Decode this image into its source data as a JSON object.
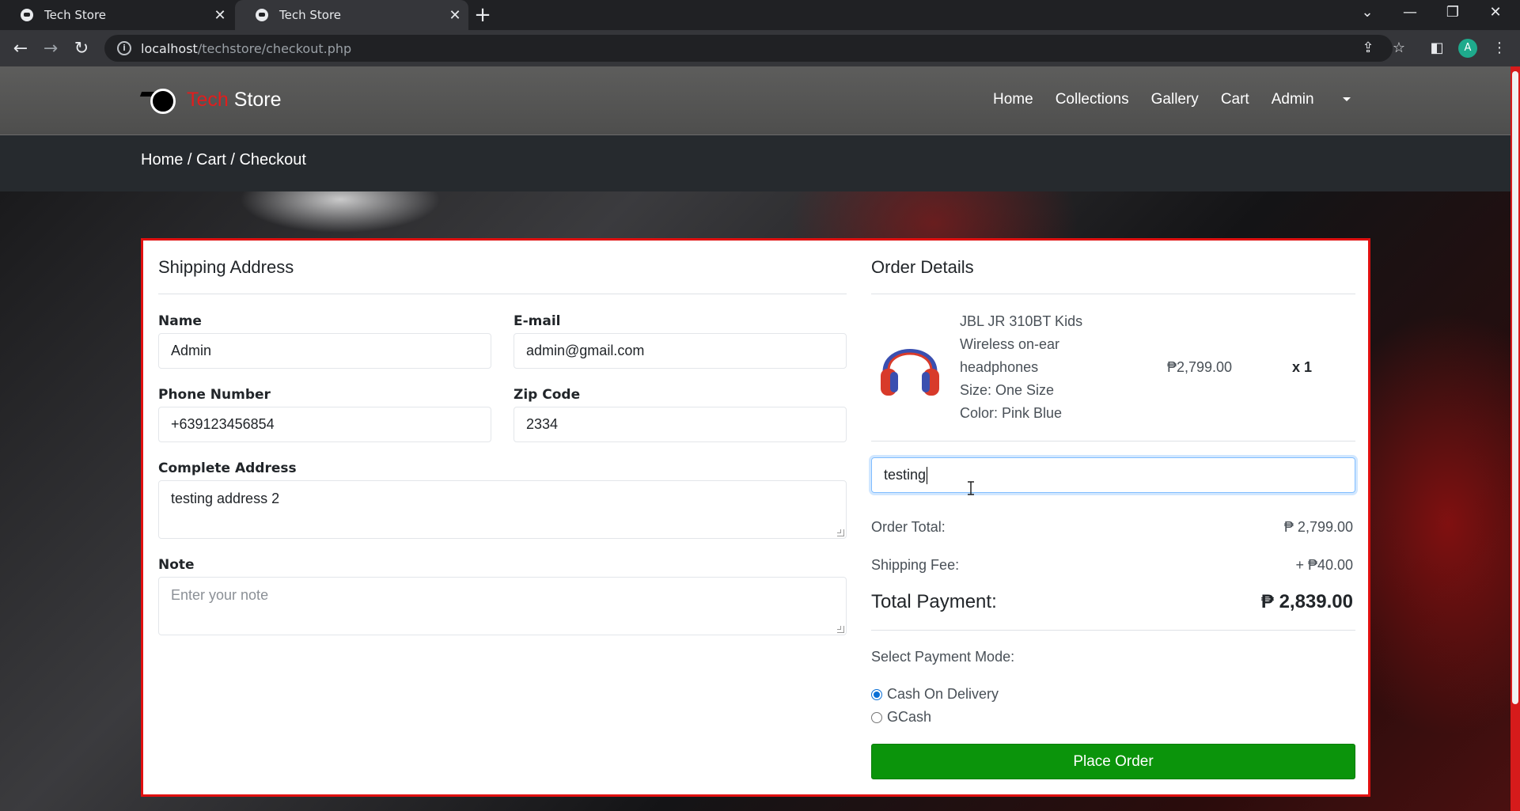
{
  "browser": {
    "tabs": [
      {
        "title": "Tech Store",
        "active": false
      },
      {
        "title": "Tech Store",
        "active": true
      }
    ],
    "url_host": "localhost",
    "url_path": "/techstore/checkout.php",
    "profile_initial": "A"
  },
  "site": {
    "brand_part1": "Tech",
    "brand_part2": "Store",
    "nav": [
      "Home",
      "Collections",
      "Gallery",
      "Cart",
      "Admin"
    ],
    "breadcrumb": "Home / Cart / Checkout"
  },
  "shipping": {
    "title": "Shipping Address",
    "name_label": "Name",
    "name_value": "Admin",
    "email_label": "E-mail",
    "email_value": "admin@gmail.com",
    "phone_label": "Phone Number",
    "phone_value": "+639123456854",
    "zip_label": "Zip Code",
    "zip_value": "2334",
    "address_label": "Complete Address",
    "address_value": "testing address 2",
    "note_label": "Note",
    "note_placeholder": "Enter your note"
  },
  "order": {
    "title": "Order Details",
    "item": {
      "name_lines": [
        "JBL JR 310BT Kids",
        "Wireless on-ear",
        "headphones"
      ],
      "size": "Size: One Size",
      "color": "Color: Pink Blue",
      "price": "₱2,799.00",
      "qty": "x 1"
    },
    "coupon_value": "testing",
    "order_total_label": "Order Total:",
    "order_total_value": "₱ 2,799.00",
    "shipping_label": "Shipping Fee:",
    "shipping_value": "+ ₱40.00",
    "total_label": "Total Payment:",
    "total_value": "₱ 2,839.00",
    "payment_label": "Select Payment Mode:",
    "payment_options": [
      {
        "label": "Cash On Delivery",
        "selected": true
      },
      {
        "label": "GCash",
        "selected": false
      }
    ],
    "place_order": "Place Order"
  },
  "colors": {
    "accent_red": "#e01010",
    "button_green": "#0b940b",
    "radio_blue": "#0a6fd6"
  }
}
